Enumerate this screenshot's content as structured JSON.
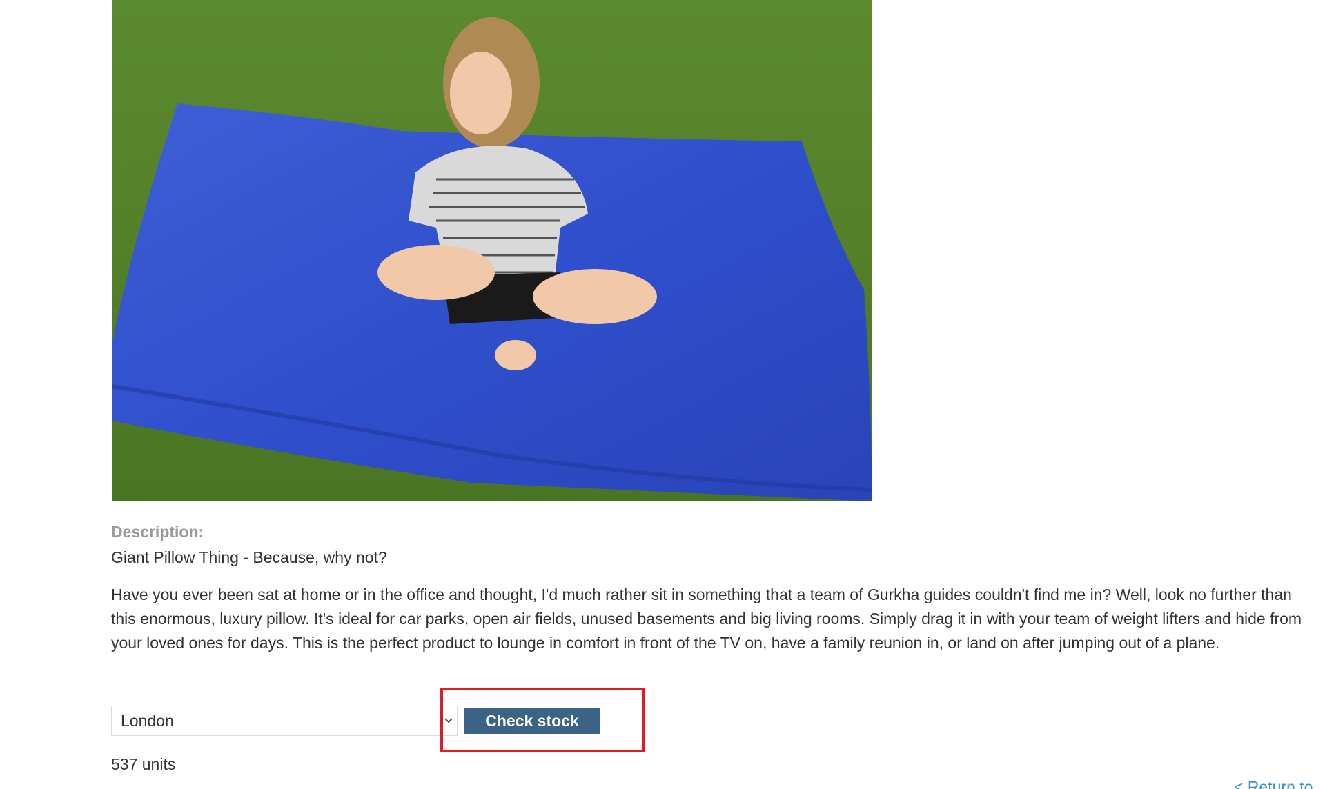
{
  "product": {
    "image_alt": "Giant Pillow Thing",
    "description_label": "Description:",
    "title": "Giant Pillow Thing - Because, why not?",
    "description": "Have you ever been sat at home or in the office and thought, I'd much rather sit in something that a team of Gurkha guides couldn't find me in? Well, look no further than this enormous, luxury pillow. It's ideal for car parks, open air fields, unused basements and big living rooms. Simply drag it in with your team of weight lifters and hide from your loved ones for days. This is the perfect product to lounge in comfort in front of the TV on, have a family reunion in, or land on after jumping out of a plane."
  },
  "stock_check": {
    "selected_store": "London",
    "button_label": "Check stock",
    "result": "537 units"
  },
  "navigation": {
    "return_link": "< Return to"
  },
  "colors": {
    "button_bg": "#3b6385",
    "highlight_border": "#e01b24",
    "link": "#3a8fc7",
    "label_gray": "#999999"
  }
}
